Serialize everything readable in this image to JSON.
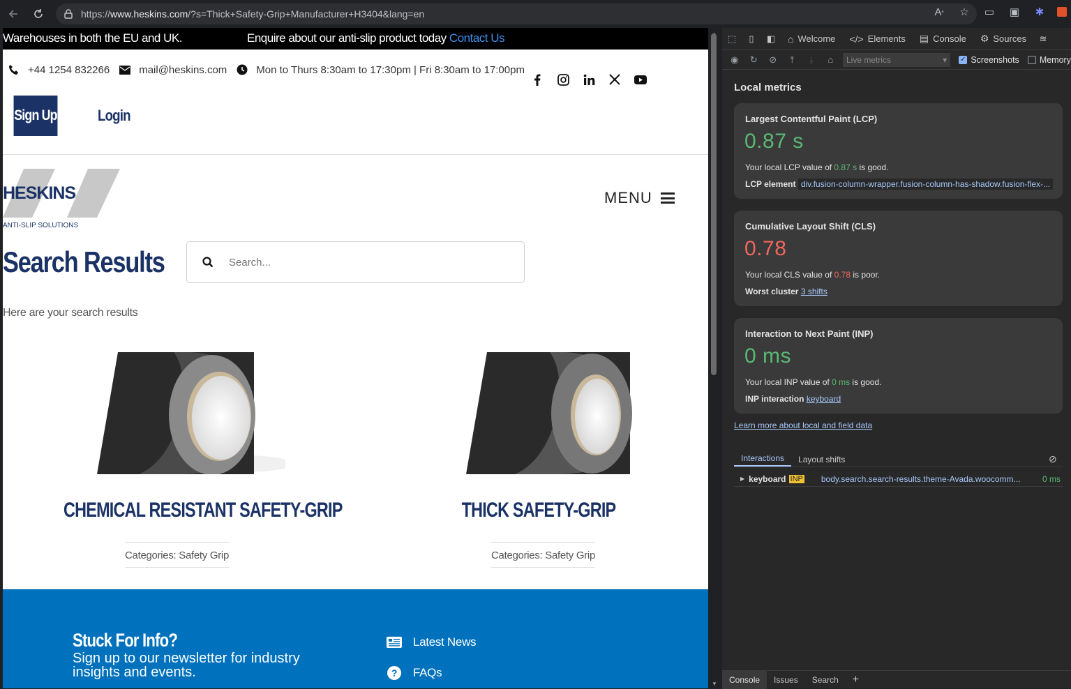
{
  "browser": {
    "url_prefix": "https://",
    "url_host": "www.heskins.com",
    "url_rest": "/?s=Thick+Safety-Grip+Manufacturer+H3404&lang=en"
  },
  "topbar": {
    "left_text": "Warehouses in both the EU and UK.",
    "mid_text": "Enquire about our anti-slip product today ",
    "contact_link": "Contact Us"
  },
  "contact": {
    "phone": "+44 1254 832266",
    "email": "mail@heskins.com",
    "hours": "Mon to Thurs 8:30am to 17:30pm | Fri 8:30am to 17:00pm"
  },
  "auth": {
    "signup": "Sign Up",
    "login": "Login"
  },
  "logo": {
    "name": "HESKINS",
    "tagline": "ANTI-SLIP SOLUTIONS"
  },
  "menu_label": "MENU",
  "main": {
    "title": "Search Results",
    "search_placeholder": "Search...",
    "subtext": "Here are your search results"
  },
  "products": [
    {
      "title": "CHEMICAL RESISTANT SAFETY-GRIP",
      "category": "Categories: Safety Grip"
    },
    {
      "title": "THICK SAFETY-GRIP",
      "category": "Categories: Safety Grip"
    }
  ],
  "footer": {
    "title": "Stuck For Info?",
    "subtitle": "Sign up to our newsletter for industry insights and events.",
    "links": [
      "Latest News",
      "FAQs"
    ]
  },
  "devtools": {
    "tabs": [
      "Welcome",
      "Elements",
      "Console",
      "Sources"
    ],
    "live_metrics": "Live metrics",
    "screenshots": "Screenshots",
    "memory": "Memory",
    "section_title": "Local metrics",
    "lcp": {
      "title": "Largest Contentful Paint (LCP)",
      "value": "0.87 s",
      "desc_prefix": "Your local LCP value of ",
      "desc_value": "0.87 s",
      "desc_suffix": " is good.",
      "detail_label": "LCP element",
      "detail_value": "div.fusion-column-wrapper.fusion-column-has-shadow.fusion-flex-..."
    },
    "cls": {
      "title": "Cumulative Layout Shift (CLS)",
      "value": "0.78",
      "desc_prefix": "Your local CLS value of ",
      "desc_value": "0.78",
      "desc_suffix": " is poor.",
      "detail_label": "Worst cluster",
      "detail_value": "3 shifts"
    },
    "inp": {
      "title": "Interaction to Next Paint (INP)",
      "value": "0 ms",
      "desc_prefix": "Your local INP value of ",
      "desc_value": "0 ms",
      "desc_suffix": " is good.",
      "detail_label": "INP interaction",
      "detail_value": "keyboard"
    },
    "learn_more": "Learn more about local and field data",
    "subtabs": [
      "Interactions",
      "Layout shifts"
    ],
    "interaction_row": {
      "type": "keyboard",
      "badge": "INP",
      "element": "body.search.search-results.theme-Avada.woocomm...",
      "duration": "0 ms"
    },
    "drawer_tabs": [
      "Console",
      "Issues",
      "Search"
    ]
  },
  "colors": {
    "brand_navy": "#1b3266",
    "footer_blue": "#0071bc",
    "good": "#5bb974",
    "poor": "#ee675c"
  }
}
